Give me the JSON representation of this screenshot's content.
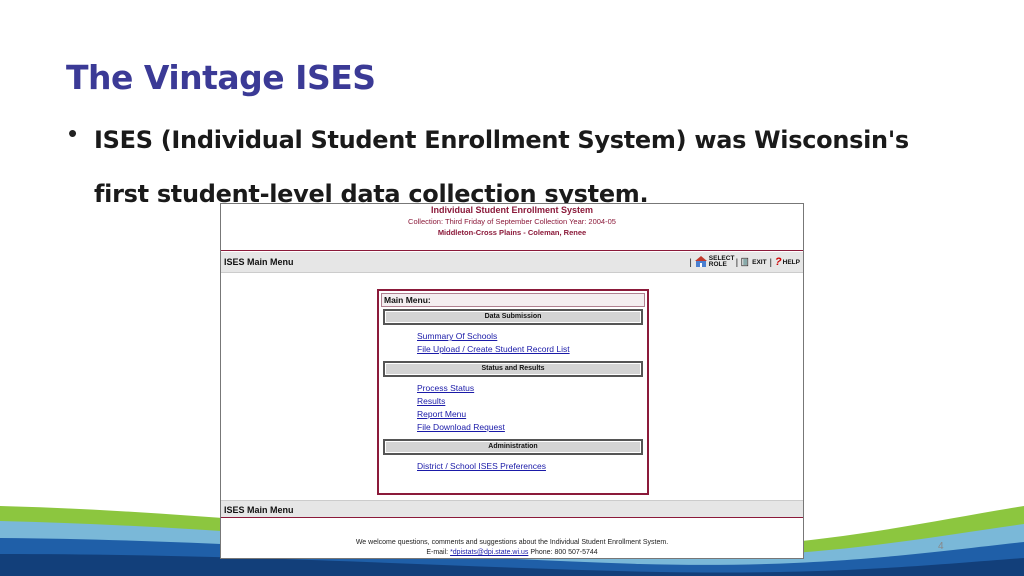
{
  "slide": {
    "title": "The Vintage ISES",
    "bullet": "ISES (Individual Student Enrollment System) was Wisconsin's first student-level data collection system.",
    "page_number": "4"
  },
  "app": {
    "title": "Individual Student Enrollment System",
    "collection": "Collection: Third Friday of September     Collection Year: 2004-05",
    "district": "Middleton-Cross Plains - Coleman, Renee",
    "menu_bar_label": "ISES Main Menu",
    "top_links": {
      "select_role": "SELECT ROLE",
      "exit": "EXIT",
      "help": "HELP"
    },
    "main_menu_label": "Main Menu:",
    "sections": [
      {
        "header": "Data Submission",
        "links": [
          "Summary Of Schools",
          "File Upload / Create Student Record List"
        ]
      },
      {
        "header": "Status and Results",
        "links": [
          "Process Status",
          "Results",
          "Report Menu",
          "File Download Request"
        ]
      },
      {
        "header": "Administration",
        "links": [
          "District / School ISES Preferences"
        ]
      }
    ],
    "bottom_bar_label": "ISES Main Menu",
    "footer_line1": "We welcome questions, comments and suggestions about the Individual Student Enrollment System.",
    "footer_email_prefix": "E-mail: ",
    "footer_email": "*dpistats@dpi.state.wi.us",
    "footer_phone": " Phone: 800 507-5744"
  },
  "colors": {
    "title": "#3b3a96",
    "app_maroon": "#8b1a3a",
    "link_blue": "#1a1aa8",
    "wave_green": "#8cc63f",
    "wave_blue": "#1f5fa8"
  }
}
